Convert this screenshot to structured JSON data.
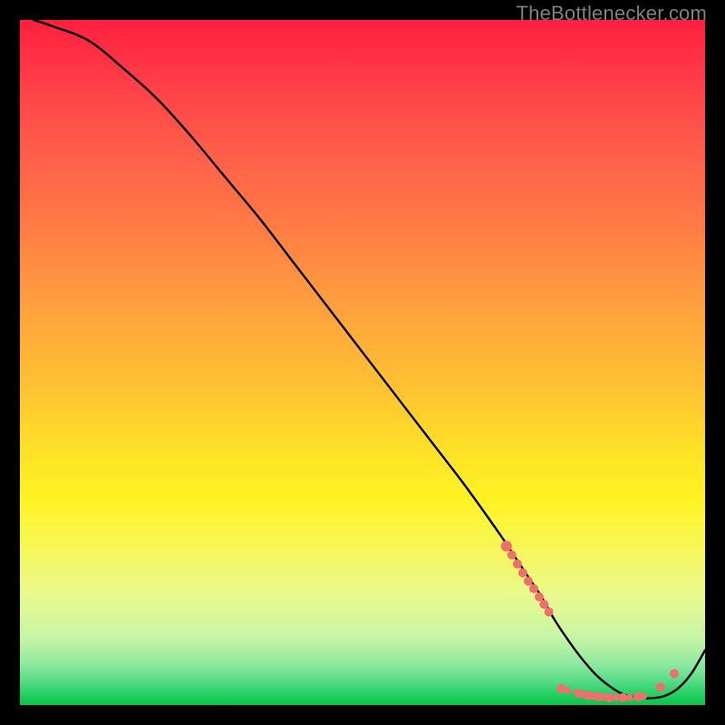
{
  "watermark": "TheBottlenecker.com",
  "colors": {
    "page_bg": "#000000",
    "marker": "#ef6e6e",
    "curve": "#000000"
  },
  "chart_data": {
    "type": "line",
    "title": "",
    "xlabel": "",
    "ylabel": "",
    "xlim": [
      0,
      100
    ],
    "ylim": [
      0,
      100
    ],
    "grid": false,
    "legend": false,
    "series": [
      {
        "name": "curve",
        "x": [
          2,
          5,
          10,
          15,
          20,
          25,
          30,
          35,
          40,
          45,
          50,
          55,
          60,
          65,
          70,
          72,
          74,
          76,
          78,
          80,
          82,
          84,
          86,
          88,
          90,
          92,
          94,
          96,
          98,
          100
        ],
        "values": [
          100,
          99,
          97,
          93,
          88.5,
          83,
          77,
          71,
          64.5,
          58,
          51.5,
          45,
          38.5,
          32,
          25,
          22,
          19,
          16,
          12.5,
          9.5,
          6.8,
          4.5,
          2.8,
          1.6,
          1.1,
          1.0,
          1.3,
          2.4,
          4.6,
          8.0
        ]
      }
    ],
    "markers": [
      {
        "x": 71.0,
        "y": 23.2,
        "r": 6
      },
      {
        "x": 71.8,
        "y": 21.9,
        "r": 5
      },
      {
        "x": 72.6,
        "y": 20.6,
        "r": 5
      },
      {
        "x": 73.4,
        "y": 19.3,
        "r": 5
      },
      {
        "x": 74.2,
        "y": 18.1,
        "r": 5
      },
      {
        "x": 75.0,
        "y": 17.0,
        "r": 5
      },
      {
        "x": 75.8,
        "y": 15.8,
        "r": 5
      },
      {
        "x": 76.5,
        "y": 14.7,
        "r": 5
      },
      {
        "x": 77.2,
        "y": 13.6,
        "r": 5
      },
      {
        "x": 79.0,
        "y": 2.4,
        "r": 5
      },
      {
        "x": 80.0,
        "y": 2.1,
        "r": 4
      },
      {
        "x": 81.5,
        "y": 1.7,
        "r": 5
      },
      {
        "x": 82.3,
        "y": 1.5,
        "r": 4
      },
      {
        "x": 83.0,
        "y": 1.4,
        "r": 5
      },
      {
        "x": 83.8,
        "y": 1.3,
        "r": 4
      },
      {
        "x": 84.5,
        "y": 1.2,
        "r": 5
      },
      {
        "x": 85.2,
        "y": 1.15,
        "r": 4
      },
      {
        "x": 86.0,
        "y": 1.1,
        "r": 5
      },
      {
        "x": 87.0,
        "y": 1.1,
        "r": 4
      },
      {
        "x": 88.0,
        "y": 1.1,
        "r": 5
      },
      {
        "x": 89.0,
        "y": 1.1,
        "r": 4
      },
      {
        "x": 90.2,
        "y": 1.2,
        "r": 5
      },
      {
        "x": 91.0,
        "y": 1.3,
        "r": 4
      },
      {
        "x": 93.5,
        "y": 2.6,
        "r": 5
      },
      {
        "x": 95.5,
        "y": 4.6,
        "r": 5
      }
    ]
  }
}
